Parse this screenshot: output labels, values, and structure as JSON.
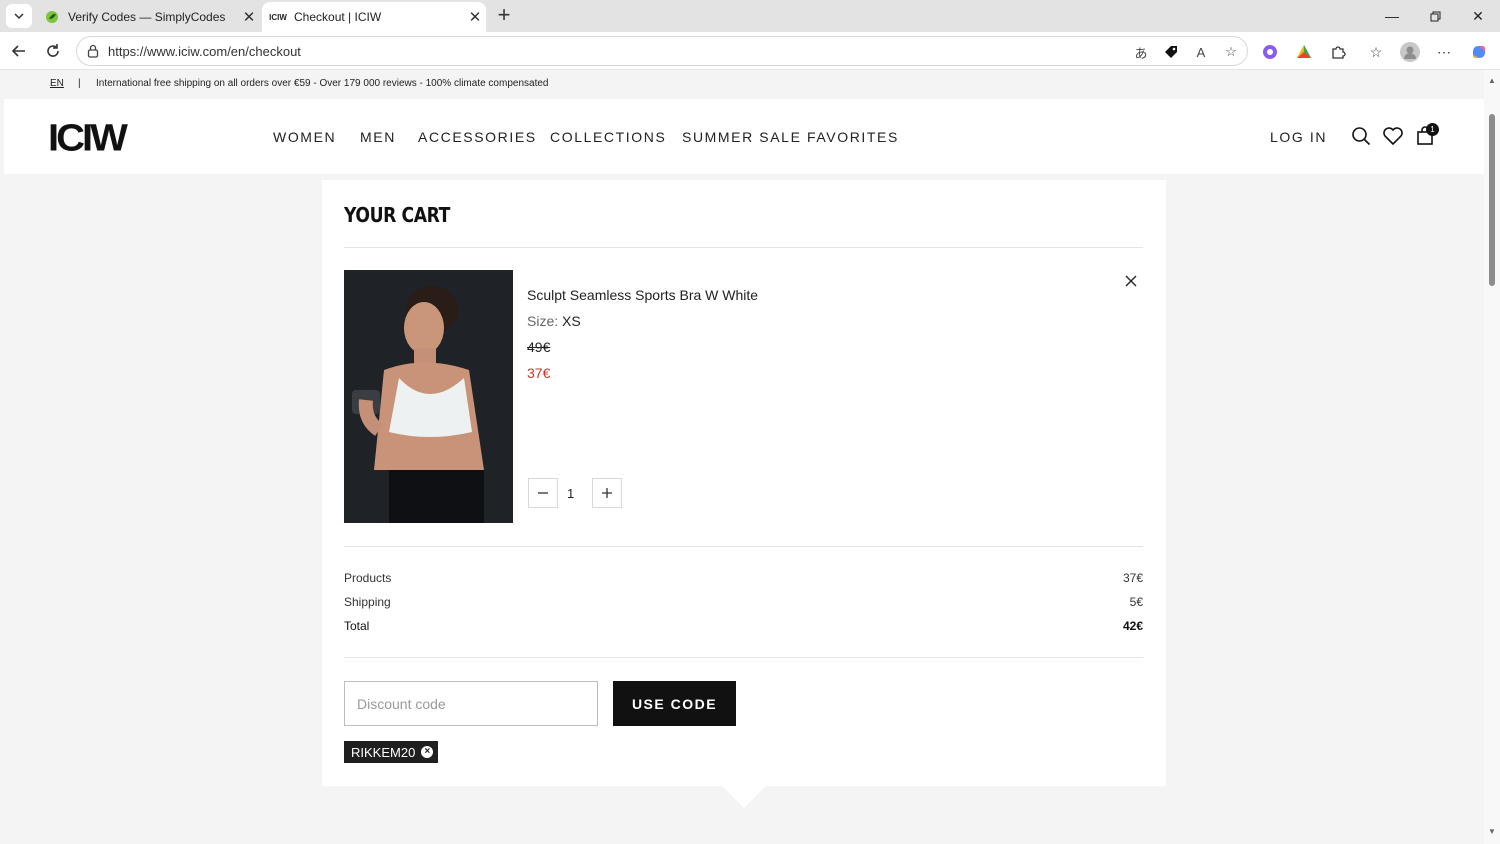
{
  "browser": {
    "tabs": [
      {
        "title": "Verify Codes — SimplyCodes",
        "favicon": "simplycodes-leaf-icon",
        "active": false
      },
      {
        "title": "Checkout | ICIW",
        "favicon": "ICIW",
        "active": true
      }
    ],
    "url": "https://www.iciw.com/en/checkout"
  },
  "announcement": {
    "language": "EN",
    "separator": "|",
    "message": "International free shipping on all orders over €59 - Over 179 000 reviews - 100% climate compensated"
  },
  "header": {
    "logo": "ICIW",
    "nav": [
      "WOMEN",
      "MEN",
      "ACCESSORIES",
      "COLLECTIONS",
      "SUMMER SALE FAVORITES"
    ],
    "login": "LOG IN",
    "cart_count": "1"
  },
  "cart": {
    "title": "YOUR CART",
    "item": {
      "name": "Sculpt Seamless Sports Bra W White",
      "size_label": "Size:",
      "size_value": "XS",
      "original_price": "49€",
      "sale_price": "37€",
      "quantity": "1"
    },
    "summary": [
      {
        "label": "Products",
        "amount": "37€"
      },
      {
        "label": "Shipping",
        "amount": "5€"
      },
      {
        "label": "Total",
        "amount": "42€"
      }
    ],
    "discount": {
      "placeholder": "Discount code",
      "button_label": "USE CODE",
      "applied_code": "RIKKEM20"
    }
  },
  "colors": {
    "accent": "#111111",
    "sale_price": "#c0392b"
  }
}
